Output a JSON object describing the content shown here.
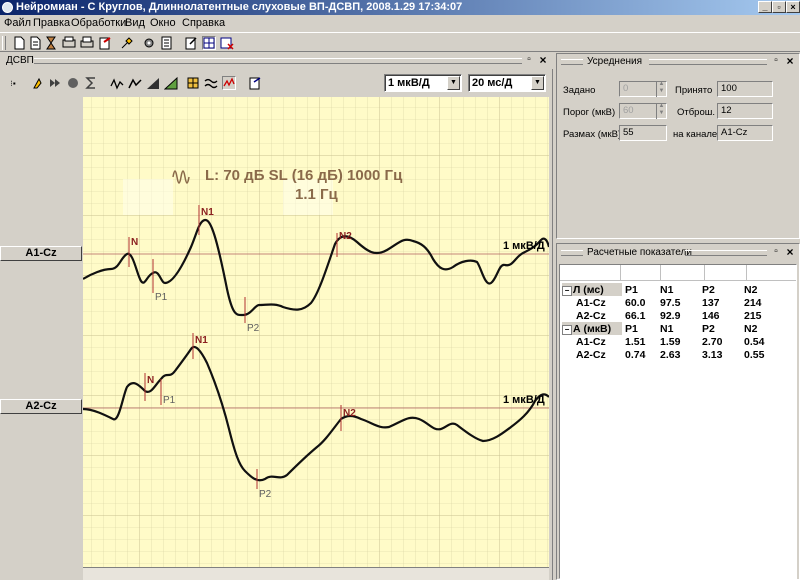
{
  "window": {
    "title": "Нейромиан - С Круглов, Длиннолатентные слуховые ВП-ДСВП, 2008.1.29 17:34:07"
  },
  "menu": [
    "Файл",
    "Правка",
    "Обработки",
    "Вид",
    "Окно",
    "Справка"
  ],
  "main_panel": {
    "title": "ДСВП",
    "amplitude_scale": "1 мкВ/Д",
    "time_scale": "20 мс/Д",
    "stimulus_line1": "L: 70 дБ SL (16 дБ)  1000 Гц",
    "stimulus_line2": "1.1 Гц",
    "channels": [
      {
        "label": "A1-Cz",
        "scale_label": "1 мкВ/Д",
        "markers": [
          "N",
          "P1",
          "N1",
          "P2",
          "N2"
        ]
      },
      {
        "label": "A2-Cz",
        "scale_label": "1 мкВ/Д",
        "markers": [
          "N",
          "P1",
          "N1",
          "P2",
          "N2"
        ]
      }
    ]
  },
  "averaging_panel": {
    "title": "Усреднения",
    "fields": {
      "given": {
        "label": "Задано",
        "value": "0"
      },
      "threshold": {
        "label": "Порог (мкВ)",
        "value": "60"
      },
      "range": {
        "label": "Размах (мкВ)",
        "value": "55"
      },
      "accepted": {
        "label": "Принято",
        "value": "100"
      },
      "rejected": {
        "label": "Отброш.",
        "value": "12"
      },
      "channel": {
        "label": "на канале",
        "value": "A1-Cz"
      }
    }
  },
  "results_panel": {
    "title": "Расчетные показатели",
    "latency": {
      "header": [
        "Л (мс)",
        "P1",
        "N1",
        "P2",
        "N2"
      ],
      "rows": [
        [
          "A1-Cz",
          "60.0",
          "97.5",
          "137",
          "214"
        ],
        [
          "A2-Cz",
          "66.1",
          "92.9",
          "146",
          "215"
        ]
      ]
    },
    "amplitude": {
      "header": [
        "А (мкВ)",
        "P1",
        "N1",
        "P2",
        "N2"
      ],
      "rows": [
        [
          "A1-Cz",
          "1.51",
          "1.59",
          "2.70",
          "0.54"
        ],
        [
          "A2-Cz",
          "0.74",
          "2.63",
          "3.13",
          "0.55"
        ]
      ]
    }
  }
}
